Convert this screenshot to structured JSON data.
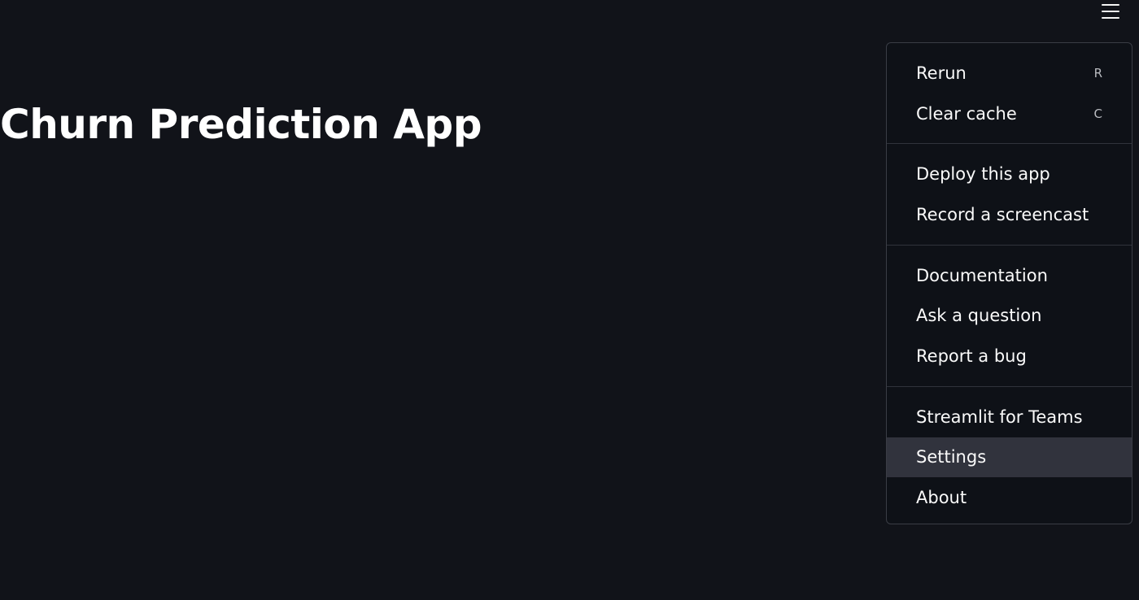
{
  "app": {
    "title": "Churn Prediction App"
  },
  "main_menu": {
    "toggle_icon": "hamburger-menu-icon",
    "groups": [
      {
        "items": [
          {
            "label": "Rerun",
            "shortcut": "R"
          },
          {
            "label": "Clear cache",
            "shortcut": "C"
          }
        ]
      },
      {
        "items": [
          {
            "label": "Deploy this app"
          },
          {
            "label": "Record a screencast"
          }
        ]
      },
      {
        "items": [
          {
            "label": "Documentation"
          },
          {
            "label": "Ask a question"
          },
          {
            "label": "Report a bug"
          }
        ]
      },
      {
        "items": [
          {
            "label": "Streamlit for Teams"
          },
          {
            "label": "Settings",
            "active": true
          },
          {
            "label": "About"
          }
        ]
      }
    ]
  },
  "colors": {
    "background": "#111319",
    "menu_background": "#0e1117",
    "menu_hover": "#31333d",
    "text": "#fafafa"
  }
}
